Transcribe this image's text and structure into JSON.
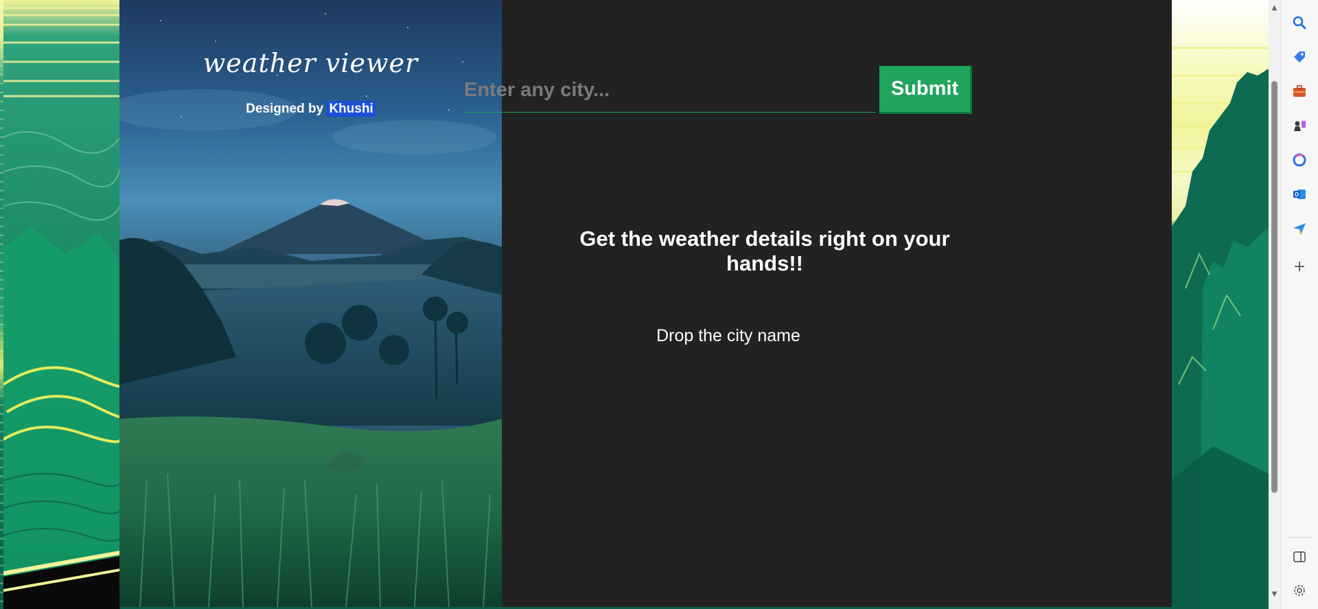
{
  "app": {
    "title": "weather viewer",
    "credit_prefix": "Designed by",
    "credit_name": "Khushi"
  },
  "search": {
    "placeholder": "Enter any city...",
    "value": "",
    "submit_label": "Submit"
  },
  "main": {
    "tagline": "Get the weather details right on your hands!!",
    "hint": "Drop the city name"
  },
  "colors": {
    "accent": "#1fa55c",
    "panel_bg": "#222222",
    "highlight": "#1a4fd8"
  },
  "edge_sidebar": {
    "items": [
      "search-icon",
      "tag-icon",
      "briefcase-icon",
      "games-icon",
      "copilot-icon",
      "outlook-icon",
      "send-icon",
      "add-icon",
      "split-screen-icon",
      "settings-icon"
    ]
  }
}
